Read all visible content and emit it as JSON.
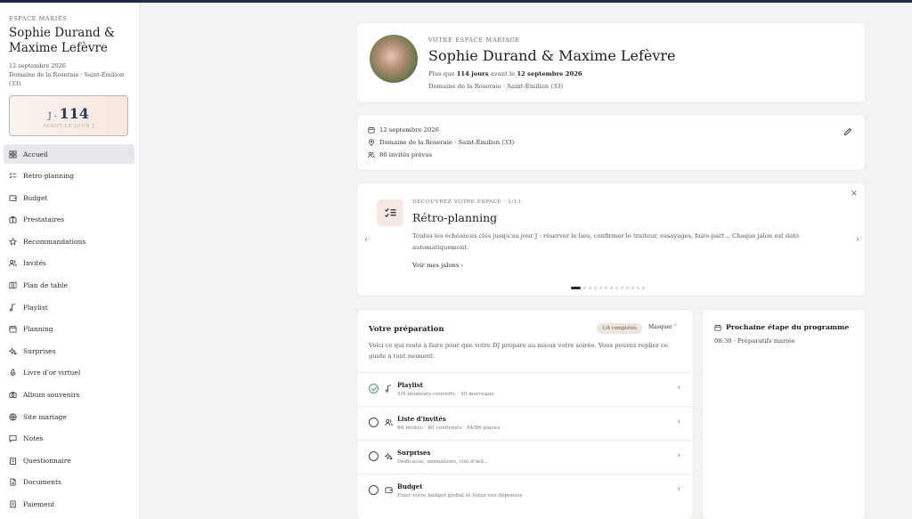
{
  "sidebar": {
    "eyebrow": "ESPACE MARIÉS",
    "names": "Sophie Durand & Maxime Lefèvre",
    "date": "12 septembre 2026",
    "place": "Domaine de la Roseraie · Saint-Émilion (33)",
    "countdown": {
      "prefix": "J -",
      "days": "114",
      "label": "AVANT LE JOUR J"
    },
    "items": [
      {
        "label": "Accueil",
        "icon": "grid-icon",
        "active": true
      },
      {
        "label": "Rétro-planning",
        "icon": "checklist-icon"
      },
      {
        "label": "Budget",
        "icon": "wallet-icon"
      },
      {
        "label": "Prestataires",
        "icon": "briefcase-icon"
      },
      {
        "label": "Recommandations",
        "icon": "star-icon"
      },
      {
        "label": "Invités",
        "icon": "users-icon"
      },
      {
        "label": "Plan de table",
        "icon": "map-icon"
      },
      {
        "label": "Playlist",
        "icon": "music-note-icon"
      },
      {
        "label": "Planning",
        "icon": "calendar-icon"
      },
      {
        "label": "Surprises",
        "icon": "sparkle-icon"
      },
      {
        "label": "Livre d'or virtuel",
        "icon": "mic-icon"
      },
      {
        "label": "Album souvenirs",
        "icon": "camera-icon"
      },
      {
        "label": "Site mariage",
        "icon": "globe-icon"
      },
      {
        "label": "Notes",
        "icon": "message-icon"
      },
      {
        "label": "Questionnaire",
        "icon": "clipboard-icon"
      },
      {
        "label": "Documents",
        "icon": "document-icon"
      },
      {
        "label": "Paiement",
        "icon": "receipt-icon"
      }
    ]
  },
  "hero": {
    "eyebrow": "VOTRE ESPACE MARIAGE",
    "title": "Sophie Durand & Maxime Lefèvre",
    "line1_pre": "Plus que ",
    "line1_days": "114 jours",
    "line1_mid": " avant le ",
    "line1_date": "12 septembre 2026",
    "line2": "Domaine de la Roseraie · Saint-Émilion (33)"
  },
  "info": {
    "date": "12 septembre 2026",
    "place": "Domaine de la Roseraie · Saint-Émilion (33)",
    "guests": "80 invités prévus"
  },
  "discover": {
    "eyebrow": "DÉCOUVREZ VOTRE ESPACE · 1/13",
    "title": "Rétro-planning",
    "text": "Toutes les échéances clés jusqu'au jour J : réserver le lieu, confirmer le traiteur, essayages, faire-part… Chaque jalon est daté automatiquement.",
    "link": "Voir mes jalons",
    "dots_total": 13,
    "dots_active": 1
  },
  "prep": {
    "title": "Votre préparation",
    "badge": "1/4 complétés",
    "hide": "Masquer",
    "desc": "Voici ce qui reste à faire pour que votre DJ prépare au mieux votre soirée. Vous pouvez replier ce guide à tout moment.",
    "tasks": [
      {
        "name": "Playlist",
        "meta": "5/9 moments couverts · 30 morceaux",
        "done": true
      },
      {
        "name": "Liste d'invités",
        "meta": "86 invités · 80 confirmés · 84/86 places",
        "done": false
      },
      {
        "name": "Surprises",
        "meta": "Dédicaces, animations, clin d'œil…",
        "done": false
      },
      {
        "name": "Budget",
        "meta": "Fixer votre budget global et listez vos dépenses",
        "done": false
      }
    ]
  },
  "next": {
    "title": "Prochaine étape du programme",
    "item": "08:30 · Préparatifs mariée"
  }
}
